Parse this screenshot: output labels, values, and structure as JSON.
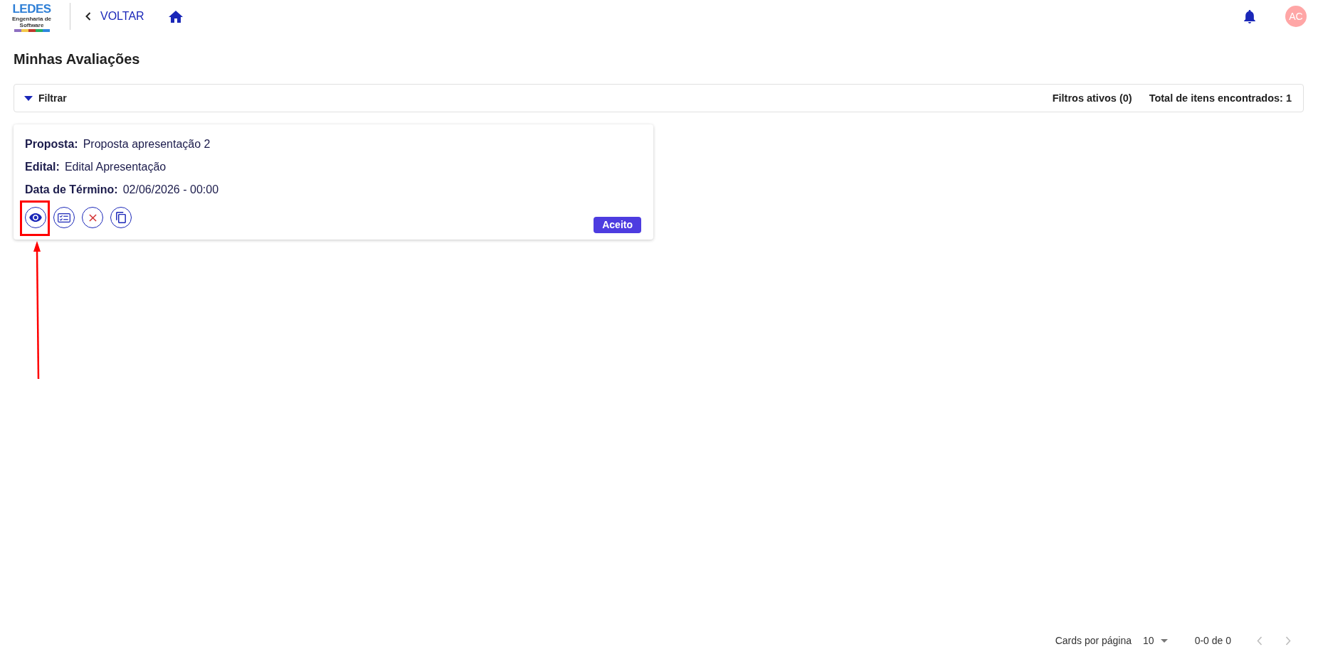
{
  "header": {
    "logo": {
      "name": "LEDES",
      "subtitle": "Engenharia de Software"
    },
    "back_link": "VOLTAR",
    "avatar": {
      "initials": "AC"
    }
  },
  "page_title": "Minhas Avaliações",
  "filter_bar": {
    "label": "Filtrar",
    "active_filters": "Filtros ativos (0)",
    "total": "Total de itens encontrados: 1"
  },
  "cards": [
    {
      "fields": [
        {
          "label": "Proposta:",
          "value": "Proposta apresentação 2"
        },
        {
          "label": "Edital:",
          "value": "Edital Apresentação"
        },
        {
          "label": "Data de Término:",
          "value": "02/06/2026 - 00:00"
        }
      ],
      "actions": [
        {
          "kind": "view",
          "annotation": {
            "kind": "box_with_arrow"
          }
        },
        {
          "kind": "checklist"
        },
        {
          "kind": "cancel"
        },
        {
          "kind": "copy"
        }
      ],
      "status": "Aceito"
    }
  ],
  "pagination": {
    "per_page_label": "Cards por página",
    "per_page": "10",
    "range": "0-0 de 0",
    "prev": {
      "disabled": true
    },
    "next": {
      "disabled": true
    }
  }
}
